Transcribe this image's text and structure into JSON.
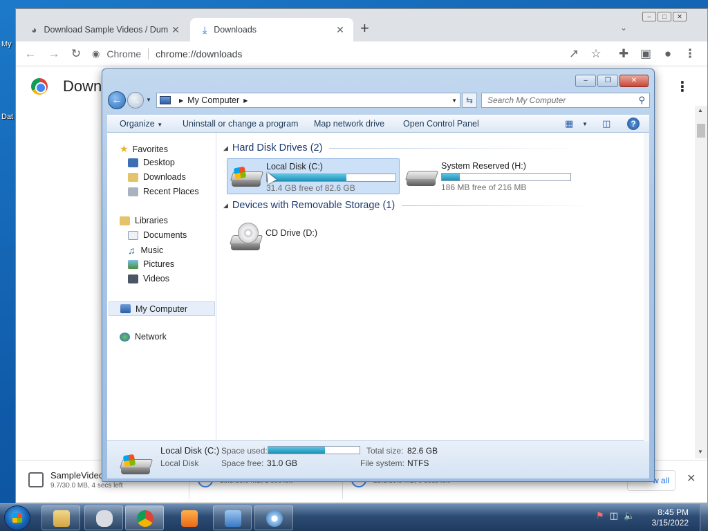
{
  "desktop": {
    "icon_labels": [
      "My",
      "Dat"
    ]
  },
  "chrome": {
    "tabs": [
      {
        "title": "Download Sample Videos / Dum",
        "icon": "globe-icon"
      },
      {
        "title": "Downloads",
        "icon": "download-icon"
      }
    ],
    "site_label": "Chrome",
    "url": "chrome://downloads",
    "page_title": "Down",
    "downloads": [
      {
        "name": "SampleVideo",
        "status": "9.7/30.0 MB, 4 secs left"
      },
      {
        "name": "",
        "status": "18.5/30.0 MB, 1 sec left"
      },
      {
        "name": "",
        "status": "23.3/30.0 MB, 0 secs left"
      }
    ],
    "show_all_label": "w all"
  },
  "explorer": {
    "breadcrumb": "My Computer",
    "search_placeholder": "Search My Computer",
    "commands": [
      "Organize",
      "Uninstall or change a program",
      "Map network drive",
      "Open Control Panel"
    ],
    "nav": {
      "favorites": "Favorites",
      "favorites_items": [
        "Desktop",
        "Downloads",
        "Recent Places"
      ],
      "libraries": "Libraries",
      "libraries_items": [
        "Documents",
        "Music",
        "Pictures",
        "Videos"
      ],
      "computer": "My Computer",
      "network": "Network"
    },
    "groups": {
      "hdd": "Hard Disk Drives (2)",
      "removable": "Devices with Removable Storage (1)"
    },
    "drives": [
      {
        "name": "Local Disk (C:)",
        "free": "31.4 GB free of 82.6 GB",
        "used_fraction": 0.62
      },
      {
        "name": "System Reserved (H:)",
        "free": "186 MB free of 216 MB",
        "used_fraction": 0.14
      }
    ],
    "cd_drive": "CD Drive (D:)",
    "details": {
      "name": "Local Disk (C:)",
      "type": "Local Disk",
      "space_used_label": "Space used:",
      "space_free_label": "Space free:",
      "space_free": "31.0 GB",
      "total_size_label": "Total size:",
      "total_size": "82.6 GB",
      "file_system_label": "File system:",
      "file_system": "NTFS",
      "used_fraction": 0.62
    }
  },
  "taskbar": {
    "time": "8:45 PM",
    "date": "3/15/2022"
  },
  "colors": {
    "bar_fill": "#1e8fb4",
    "explorer_chrome": "#a9c6e6",
    "selection": "#cce0f7"
  }
}
